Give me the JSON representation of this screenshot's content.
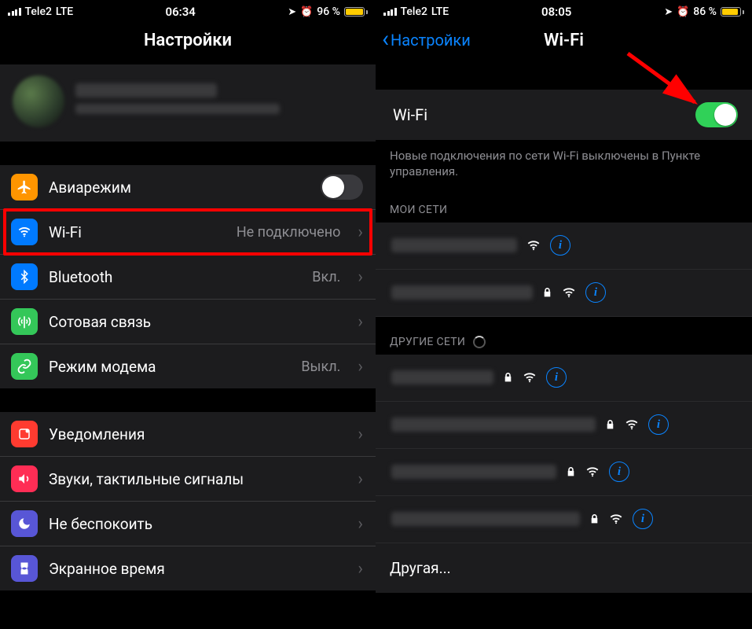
{
  "left": {
    "status": {
      "carrier": "Tele2",
      "netType": "LTE",
      "time": "06:34",
      "batteryPct": "96 %",
      "batteryFill": 96
    },
    "title": "Настройки",
    "rows": {
      "airplane": "Авиарежим",
      "wifi": "Wi-Fi",
      "wifiStatus": "Не подключено",
      "bluetooth": "Bluetooth",
      "bluetoothStatus": "Вкл.",
      "cellular": "Сотовая связь",
      "hotspot": "Режим модема",
      "hotspotStatus": "Выкл.",
      "notifications": "Уведомления",
      "sounds": "Звуки, тактильные сигналы",
      "dnd": "Не беспокоить",
      "screenTime": "Экранное время"
    }
  },
  "right": {
    "status": {
      "carrier": "Tele2",
      "netType": "LTE",
      "time": "08:05",
      "batteryPct": "86 %",
      "batteryFill": 86
    },
    "back": "Настройки",
    "title": "Wi-Fi",
    "toggleLabel": "Wi-Fi",
    "note": "Новые подключения по сети Wi-Fi выключены в Пункте управления.",
    "myNetworks": "МОИ СЕТИ",
    "otherNetworks": "ДРУГИЕ СЕТИ",
    "other": "Другая..."
  }
}
